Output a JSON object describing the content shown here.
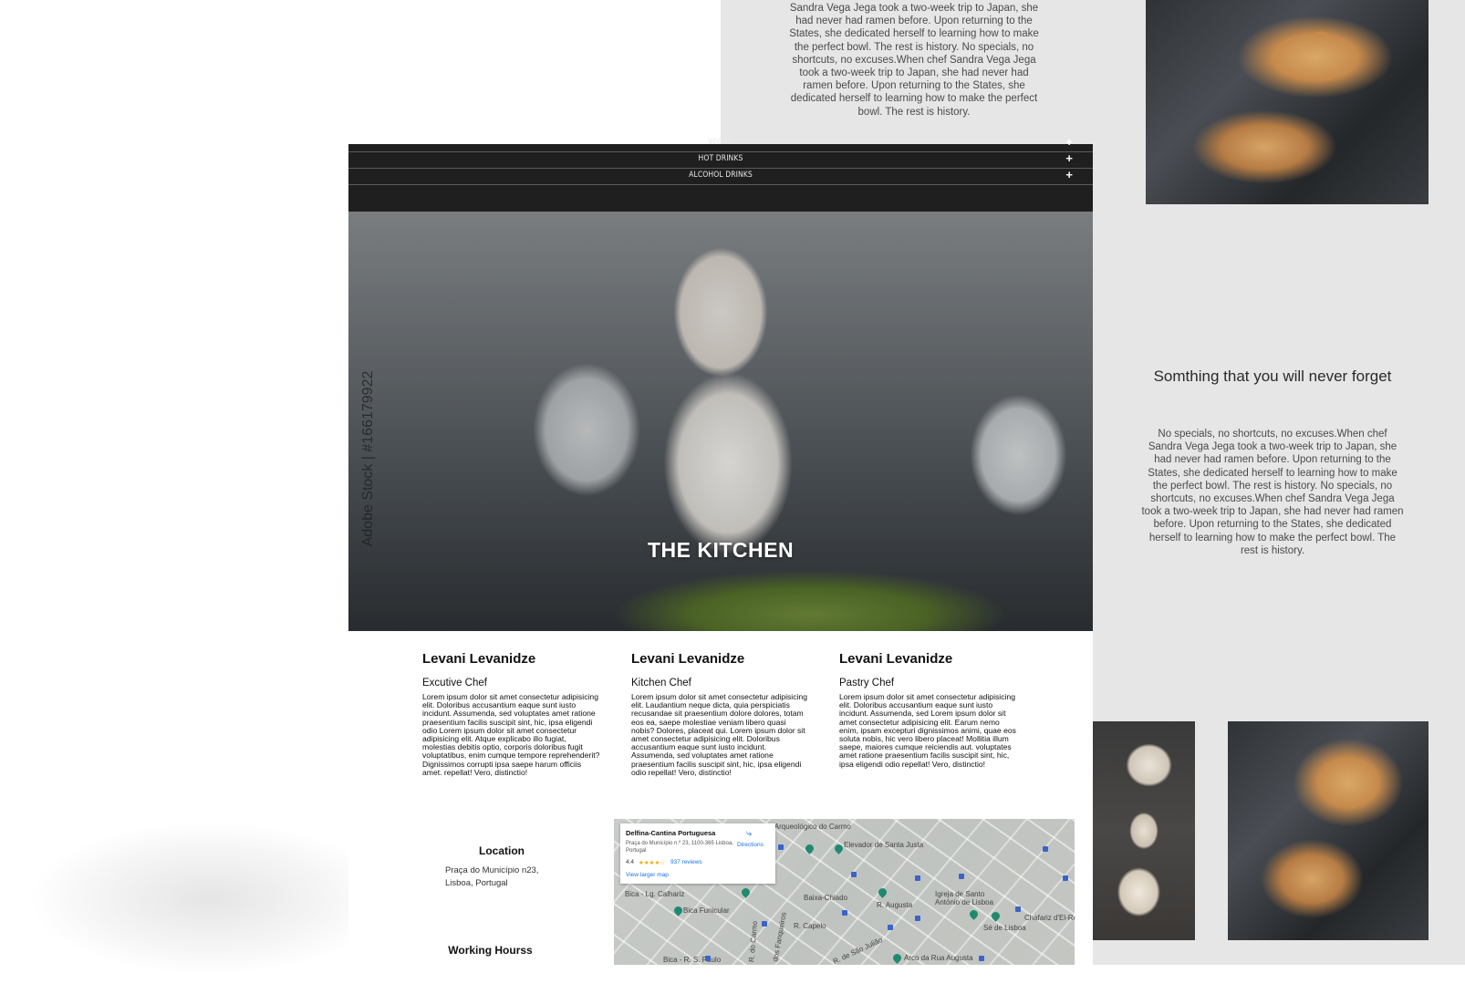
{
  "story_text": "Sandra Vega Jega took a two-week trip to Japan, she had never had ramen before. Upon returning to the States, she dedicated herself to learning how to make the perfect bowl. The rest is history. No specials, no shortcuts, no excuses.When chef Sandra Vega Jega took a two-week trip to Japan, she had never had ramen before. Upon returning to the States, she dedicated herself to learning how to make the perfect bowl. The rest is history.",
  "right_section": {
    "title": "Somthing that you will never forget",
    "text": "No specials, no shortcuts, no excuses.When chef Sandra Vega Jega took a two-week trip to Japan, she had never had ramen before. Upon returning to the States, she dedicated herself to learning how to make the perfect bowl. The rest is history. No specials, no shortcuts, no excuses.When chef Sandra Vega Jega took a two-week trip to Japan, she had never had ramen before. Upon returning to the States, she dedicated herself to learning how to make the perfect bowl. The rest is history."
  },
  "menu": {
    "items": [
      {
        "label": "VEGAN",
        "icon": "plus-icon"
      },
      {
        "label": "HOT DRINKS",
        "icon": "plus-icon"
      },
      {
        "label": "ALCOHOL DRINKS",
        "icon": "plus-icon"
      }
    ],
    "plus_glyph": "+"
  },
  "hero": {
    "title": "THE KITCHEN",
    "watermark": "Adobe Stock | #166179922"
  },
  "chefs": [
    {
      "name": "Levani Levanidze",
      "role": "Excutive Chef",
      "bio": "Lorem ipsum dolor sit amet consectetur adipisicing elit. Doloribus accusantium eaque sunt iusto incidunt. Assumenda, sed voluptates amet ratione praesentium facilis suscipit sint, hic, ipsa eligendi odio Lorem ipsum dolor sit amet consectetur adipisicing elit. Atque explicabo illo fugiat, molestias debitis optio, corporis doloribus fugit voluptatibus, enim cumque tempore reprehenderit? Dignissimos corrupti ipsa saepe harum officiis amet. repellat! Vero, distinctio!"
    },
    {
      "name": "Levani Levanidze",
      "role": "Kitchen Chef",
      "bio": "Lorem ipsum dolor sit amet consectetur adipisicing elit. Laudantium neque dicta, quia perspiciatis recusandae sit praesentium dolore dolores, totam eos ea, saepe molestiae veniam libero quasi nobis? Dolores, placeat qui. Lorem ipsum dolor sit amet consectetur adipisicing elit. Doloribus accusantium eaque sunt iusto incidunt. Assumenda, sed voluptates amet ratione praesentium facilis suscipit sint, hic, ipsa eligendi odio repellat! Vero, distinctio!"
    },
    {
      "name": "Levani Levanidze",
      "role": "Pastry Chef",
      "bio": "Lorem ipsum dolor sit amet consectetur adipisicing elit. Doloribus accusantium eaque sunt iusto incidunt. Assumenda, sed Lorem ipsum dolor sit amet consectetur adipisicing elit. Earum nemo enim, ipsam excepturi dignissimos animi, quae eos soluta nobis, hic vero libero placeat! Mollitia illum saepe, maiores cumque reiciendis aut. voluptates amet ratione praesentium facilis suscipit sint, hic, ipsa eligendi odio repellat! Vero, distinctio!"
    }
  ],
  "location": {
    "title": "Location",
    "address_line1": "Praça do Município n23,",
    "address_line2": "Lisboa, Portugal",
    "hours_title": "Working Hourss"
  },
  "map": {
    "place_name": "Delfina-Cantina Portuguesa",
    "place_address": "Praça do Município n.º 23, 1100-365 Lisboa, Portugal",
    "rating": "4.4",
    "stars": "★★★★☆",
    "reviews": "937 reviews",
    "directions": "Directions",
    "view_larger": "View larger map",
    "labels": [
      "Museu Arqueológico do Carmo",
      "Elevador de Santa Justa",
      "Bica - Lg. Calhariz",
      "Bica Funicular",
      "Baixa-Chiado",
      "R. Augusta",
      "Igreja de Santo António de Lisboa",
      "Sé de Lisboa",
      "Chafariz d'El-Re",
      "R. Capelo",
      "R. de São Julião",
      "Arco da Rua Augusta",
      "Bica - R. S. Paulo",
      "R. do Carmo",
      "R. dos Fanqueiros"
    ]
  }
}
